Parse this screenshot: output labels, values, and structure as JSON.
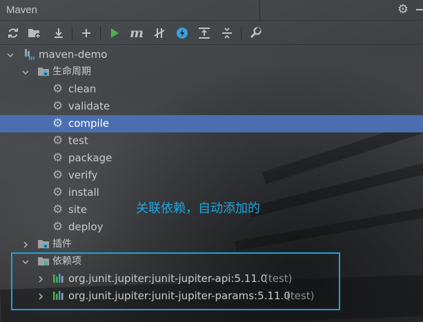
{
  "window": {
    "title": "Maven"
  },
  "toolbar": {
    "buttons": [
      {
        "name": "reload-icon"
      },
      {
        "name": "add-project-folder-icon"
      },
      {
        "name": "download-icon"
      },
      {
        "name": "plus-icon"
      },
      {
        "name": "run-icon"
      },
      {
        "name": "execute-goal-icon"
      },
      {
        "name": "toggle-offline-icon"
      },
      {
        "name": "toggle-skip-tests-icon"
      },
      {
        "name": "show-dependencies-icon"
      },
      {
        "name": "collapse-all-icon"
      },
      {
        "name": "settings-wrench-icon"
      }
    ]
  },
  "tree": {
    "project": "maven-demo",
    "lifecycle": {
      "label": "生命周期",
      "goals": [
        "clean",
        "validate",
        "compile",
        "test",
        "package",
        "verify",
        "install",
        "site",
        "deploy"
      ],
      "selected": "compile"
    },
    "plugins": {
      "label": "插件"
    },
    "dependencies": {
      "label": "依赖项",
      "items": [
        {
          "artifact": "org.junit.jupiter:junit-jupiter-api:5.11.0",
          "scope": "(test)"
        },
        {
          "artifact": "org.junit.jupiter:junit-jupiter-params:5.11.0",
          "scope": "(test)"
        }
      ]
    }
  },
  "annotation": "关联依赖，自动添加的",
  "colors": {
    "selection": "#4a6eb0",
    "highlight": "#1fa4d8",
    "run": "#4caf50"
  }
}
